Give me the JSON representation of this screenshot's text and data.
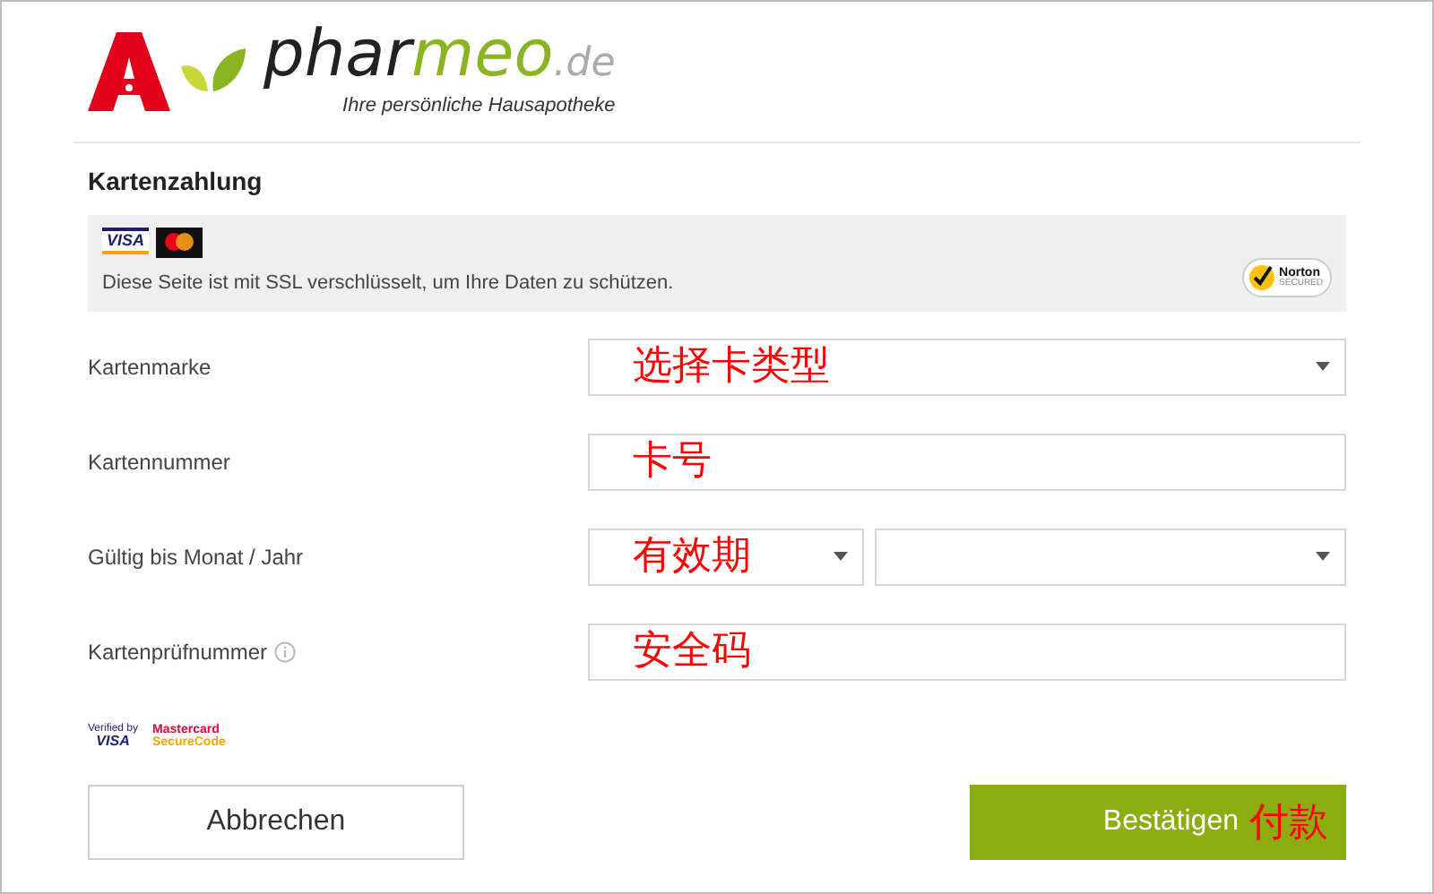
{
  "logo": {
    "brand_part_1": "phar",
    "brand_part_2": "meo",
    "domain": ".de",
    "tagline": "Ihre persönliche Hausapotheke"
  },
  "title": "Kartenzahlung",
  "security_box": {
    "card_logos": [
      {
        "kind": "visa",
        "text": "VISA"
      },
      {
        "kind": "mastercard"
      }
    ],
    "message": "Diese Seite ist mit SSL verschlüsselt, um Ihre Daten zu schützen.",
    "norton_name": "Norton",
    "norton_status": "SECURED"
  },
  "fields": [
    {
      "label": "Kartenmarke",
      "kind": "select",
      "info": false,
      "annotation": "选择卡类型"
    },
    {
      "label": "Kartennummer",
      "kind": "input",
      "info": false,
      "annotation": "卡号"
    },
    {
      "label": "Gültig bis Monat / Jahr",
      "kind": "double-select",
      "info": false,
      "annotation": "有效期"
    },
    {
      "label": "Kartenprüfnummer",
      "kind": "input",
      "info": true,
      "annotation": "安全码"
    }
  ],
  "verification_badges": {
    "visa_line_1": "Verified by",
    "visa_line_2": "VISA",
    "mc_line_1": "Mastercard",
    "mc_line_2": "SecureCode"
  },
  "buttons": {
    "cancel": "Abbrechen",
    "confirm": "Bestätigen",
    "confirm_annotation": "付款"
  }
}
